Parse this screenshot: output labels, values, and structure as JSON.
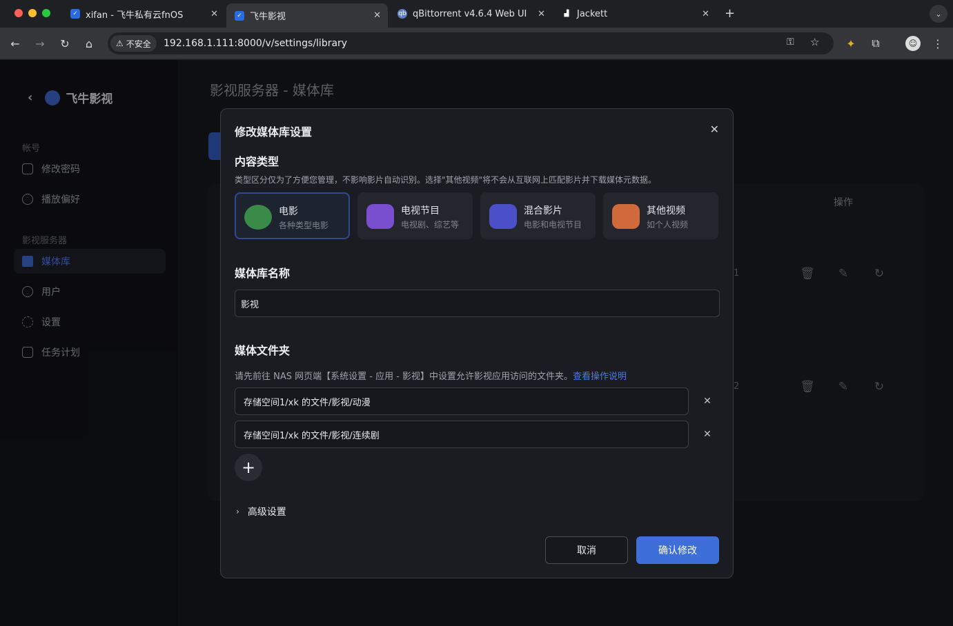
{
  "browser": {
    "tabs": [
      {
        "title": "xifan - 飞牛私有云fnOS",
        "favicon": "fnos-icon"
      },
      {
        "title": "飞牛影视",
        "favicon": "fnos-icon",
        "active": true
      },
      {
        "title": "qBittorrent v4.6.4 Web UI",
        "favicon": "qbittorrent-icon"
      },
      {
        "title": "Jackett",
        "favicon": "jackett-icon"
      }
    ],
    "security_label": "不安全",
    "url": "192.168.1.111:8000/v/settings/library"
  },
  "sidebar": {
    "brand": "飞牛影视",
    "sections": [
      {
        "title": "帐号",
        "items": [
          "修改密码",
          "播放偏好"
        ]
      },
      {
        "title": "影视服务器",
        "items": [
          "媒体库",
          "用户",
          "设置",
          "任务计划"
        ]
      }
    ],
    "active_item": "媒体库"
  },
  "main": {
    "title": "影视服务器 - 媒体库",
    "column_actions": "操作",
    "row_numbers": [
      "1",
      "2"
    ]
  },
  "modal": {
    "title": "修改媒体库设置",
    "content_type": {
      "title": "内容类型",
      "hint": "类型区分仅为了方便您管理，不影响影片自动识别。选择\"其他视频\"将不会从互联网上匹配影片并下载媒体元数据。",
      "options": [
        {
          "name": "电影",
          "desc": "各种类型电影",
          "color": "#3a8a48"
        },
        {
          "name": "电视节目",
          "desc": "电视剧、综艺等",
          "color": "#7a4fcf"
        },
        {
          "name": "混合影片",
          "desc": "电影和电视节目",
          "color": "#4b4fc8"
        },
        {
          "name": "其他视频",
          "desc": "如个人视频",
          "color": "#d06a3c"
        }
      ],
      "selected": "电影"
    },
    "library_name": {
      "title": "媒体库名称",
      "value": "影视"
    },
    "folders": {
      "title": "媒体文件夹",
      "hint": "请先前往 NAS 网页端【系统设置 - 应用 - 影视】中设置允许影视应用访问的文件夹。",
      "hint_link": "查看操作说明",
      "items": [
        "存储空间1/xk 的文件/影视/动漫",
        "存储空间1/xk 的文件/影视/连续剧"
      ],
      "add_symbol": "+"
    },
    "advanced": "高级设置",
    "cancel": "取消",
    "confirm": "确认修改"
  }
}
